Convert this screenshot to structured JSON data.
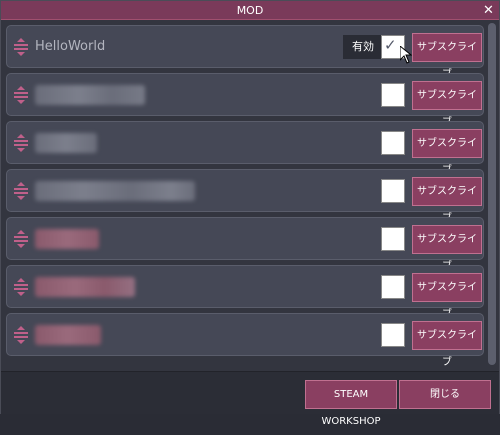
{
  "window": {
    "title": "MOD",
    "close_glyph": "✕"
  },
  "mods": [
    {
      "name": "HelloWorld",
      "blurred": false,
      "enabled": true,
      "tooltip": "有効",
      "subscribe_label": "サブスクライブ"
    },
    {
      "name": "",
      "blurred": true,
      "enabled": false,
      "subscribe_label": "サブスクライブ"
    },
    {
      "name": "",
      "blurred": true,
      "enabled": false,
      "subscribe_label": "サブスクライブ"
    },
    {
      "name": "",
      "blurred": true,
      "enabled": false,
      "subscribe_label": "サブスクライブ"
    },
    {
      "name": "",
      "blurred": true,
      "enabled": false,
      "subscribe_label": "サブスクライブ"
    },
    {
      "name": "",
      "blurred": true,
      "enabled": false,
      "subscribe_label": "サブスクライブ"
    },
    {
      "name": "",
      "blurred": true,
      "enabled": false,
      "subscribe_label": "サブスクライブ"
    }
  ],
  "footer": {
    "steam_workshop_label": "STEAM WORKSHOP",
    "close_label": "閉じる"
  },
  "colors": {
    "accent": "#8a3f61",
    "title_bar": "#7a3a5a",
    "row_bg": "#454856",
    "handle": "#c0608a"
  },
  "icons": {
    "drag": "drag-handle-icon",
    "check": "checkmark-icon",
    "close": "close-icon"
  }
}
